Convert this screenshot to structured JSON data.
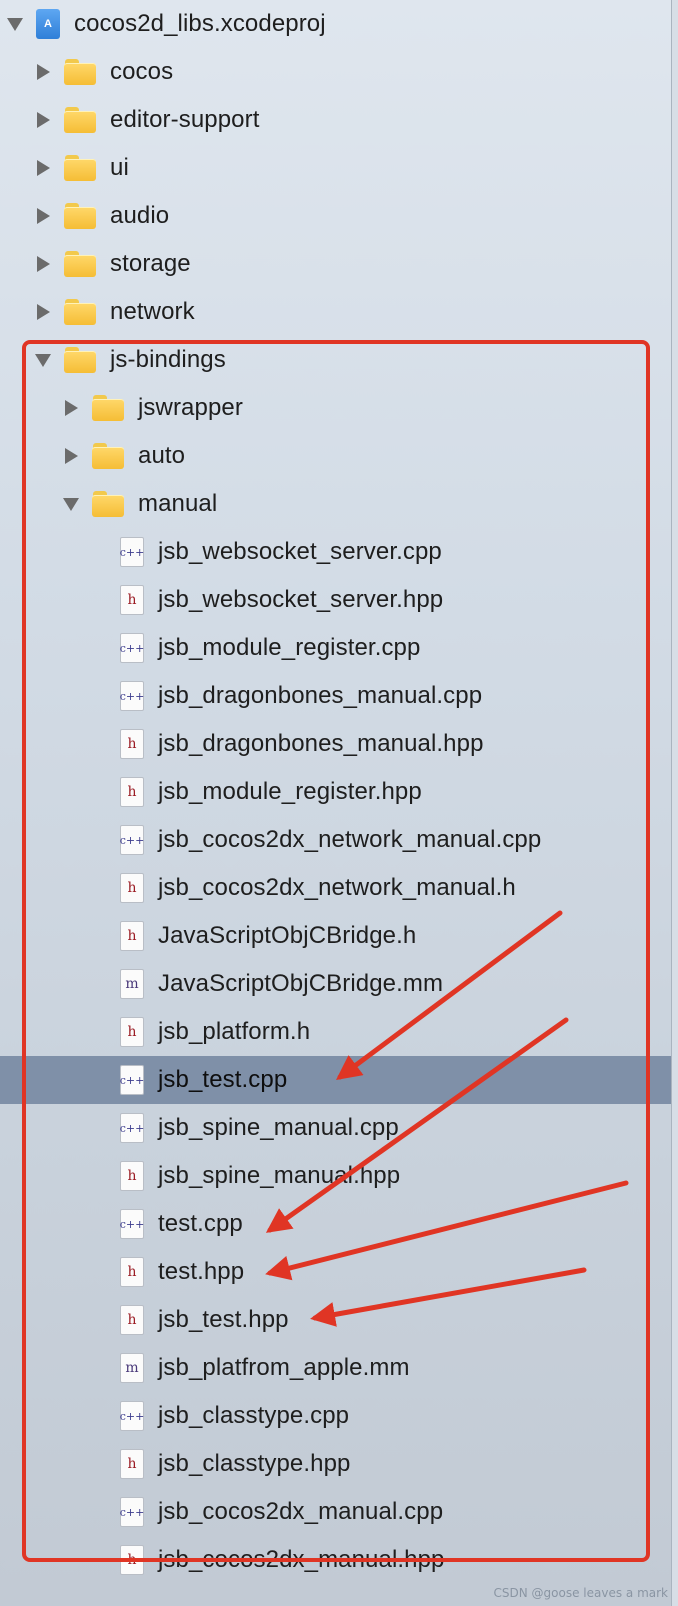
{
  "tree": [
    {
      "label": "cocos2d_libs.xcodeproj",
      "kind": "project",
      "level": 0,
      "disclosure": "down"
    },
    {
      "label": "cocos",
      "kind": "folder",
      "level": 1,
      "disclosure": "right"
    },
    {
      "label": "editor-support",
      "kind": "folder",
      "level": 1,
      "disclosure": "right"
    },
    {
      "label": "ui",
      "kind": "folder",
      "level": 1,
      "disclosure": "right"
    },
    {
      "label": "audio",
      "kind": "folder",
      "level": 1,
      "disclosure": "right"
    },
    {
      "label": "storage",
      "kind": "folder",
      "level": 1,
      "disclosure": "right"
    },
    {
      "label": "network",
      "kind": "folder",
      "level": 1,
      "disclosure": "right"
    },
    {
      "label": "js-bindings",
      "kind": "folder",
      "level": 1,
      "disclosure": "down"
    },
    {
      "label": "jswrapper",
      "kind": "folder",
      "level": 2,
      "disclosure": "right"
    },
    {
      "label": "auto",
      "kind": "folder",
      "level": 2,
      "disclosure": "right"
    },
    {
      "label": "manual",
      "kind": "folder",
      "level": 2,
      "disclosure": "down"
    },
    {
      "label": "jsb_websocket_server.cpp",
      "kind": "cpp",
      "level": 3
    },
    {
      "label": "jsb_websocket_server.hpp",
      "kind": "h",
      "level": 3
    },
    {
      "label": "jsb_module_register.cpp",
      "kind": "cpp",
      "level": 3
    },
    {
      "label": "jsb_dragonbones_manual.cpp",
      "kind": "cpp",
      "level": 3
    },
    {
      "label": "jsb_dragonbones_manual.hpp",
      "kind": "h",
      "level": 3
    },
    {
      "label": "jsb_module_register.hpp",
      "kind": "h",
      "level": 3
    },
    {
      "label": "jsb_cocos2dx_network_manual.cpp",
      "kind": "cpp",
      "level": 3
    },
    {
      "label": "jsb_cocos2dx_network_manual.h",
      "kind": "h",
      "level": 3
    },
    {
      "label": "JavaScriptObjCBridge.h",
      "kind": "h",
      "level": 3
    },
    {
      "label": "JavaScriptObjCBridge.mm",
      "kind": "mm",
      "level": 3
    },
    {
      "label": "jsb_platform.h",
      "kind": "h",
      "level": 3
    },
    {
      "label": "jsb_test.cpp",
      "kind": "cpp",
      "level": 3,
      "selected": true
    },
    {
      "label": "jsb_spine_manual.cpp",
      "kind": "cpp",
      "level": 3
    },
    {
      "label": "jsb_spine_manual.hpp",
      "kind": "h",
      "level": 3
    },
    {
      "label": "test.cpp",
      "kind": "cpp",
      "level": 3
    },
    {
      "label": "test.hpp",
      "kind": "h",
      "level": 3
    },
    {
      "label": "jsb_test.hpp",
      "kind": "h",
      "level": 3
    },
    {
      "label": "jsb_platfrom_apple.mm",
      "kind": "mm",
      "level": 3
    },
    {
      "label": "jsb_classtype.cpp",
      "kind": "cpp",
      "level": 3
    },
    {
      "label": "jsb_classtype.hpp",
      "kind": "h",
      "level": 3
    },
    {
      "label": "jsb_cocos2dx_manual.cpp",
      "kind": "cpp",
      "level": 3
    },
    {
      "label": "jsb_cocos2dx_manual.hpp",
      "kind": "h",
      "level": 3
    }
  ],
  "icon_glyphs": {
    "cpp": "c++",
    "h": "h",
    "mm": "m",
    "project": "A"
  },
  "annotation_color": "#e03524",
  "selection_color": "#7f90a8",
  "watermark": "CSDN @goose leaves a mark"
}
